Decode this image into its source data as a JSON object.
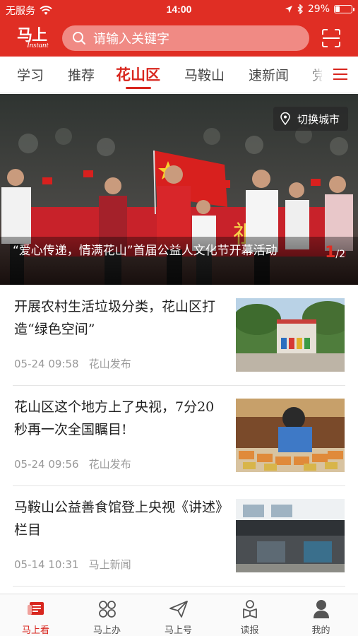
{
  "status_bar": {
    "carrier": "无服务",
    "time": "14:00",
    "battery": "29%",
    "battery_level": 0.29
  },
  "header": {
    "logo_cn": "马上",
    "logo_en": "Instant",
    "search_placeholder": "请输入关键字"
  },
  "tabs": [
    {
      "label": "学习"
    },
    {
      "label": "推荐"
    },
    {
      "label": "花山区",
      "active": true
    },
    {
      "label": "马鞍山"
    },
    {
      "label": "速新闻"
    },
    {
      "label": "党"
    }
  ],
  "hero": {
    "city_switch": "切换城市",
    "caption": "“爱心传递，情满花山”首届公益人文化节开幕活动",
    "page_current": "1",
    "page_total": "/2"
  },
  "news": [
    {
      "title": "开展农村生活垃圾分类，花山区打造“绿色空间”",
      "time": "05-24 09:58",
      "source": "花山发布"
    },
    {
      "title": "花山区这个地方上了央视，7分20秒再一次全国瞩目!",
      "time": "05-24 09:56",
      "source": "花山发布"
    },
    {
      "title": "马鞍山公益善食馆登上央视《讲述》栏目",
      "time": "05-14 10:31",
      "source": "马上新闻"
    }
  ],
  "bottom_nav": [
    {
      "label": "马上看",
      "icon": "newspaper-icon",
      "active": true
    },
    {
      "label": "马上办",
      "icon": "grid-flower-icon"
    },
    {
      "label": "马上号",
      "icon": "paper-plane-icon"
    },
    {
      "label": "读报",
      "icon": "reader-icon"
    },
    {
      "label": "我的",
      "icon": "person-icon"
    }
  ],
  "colors": {
    "brand_red": "#e02e24",
    "tab_active": "#d8261e",
    "meta_gray": "#999999"
  }
}
